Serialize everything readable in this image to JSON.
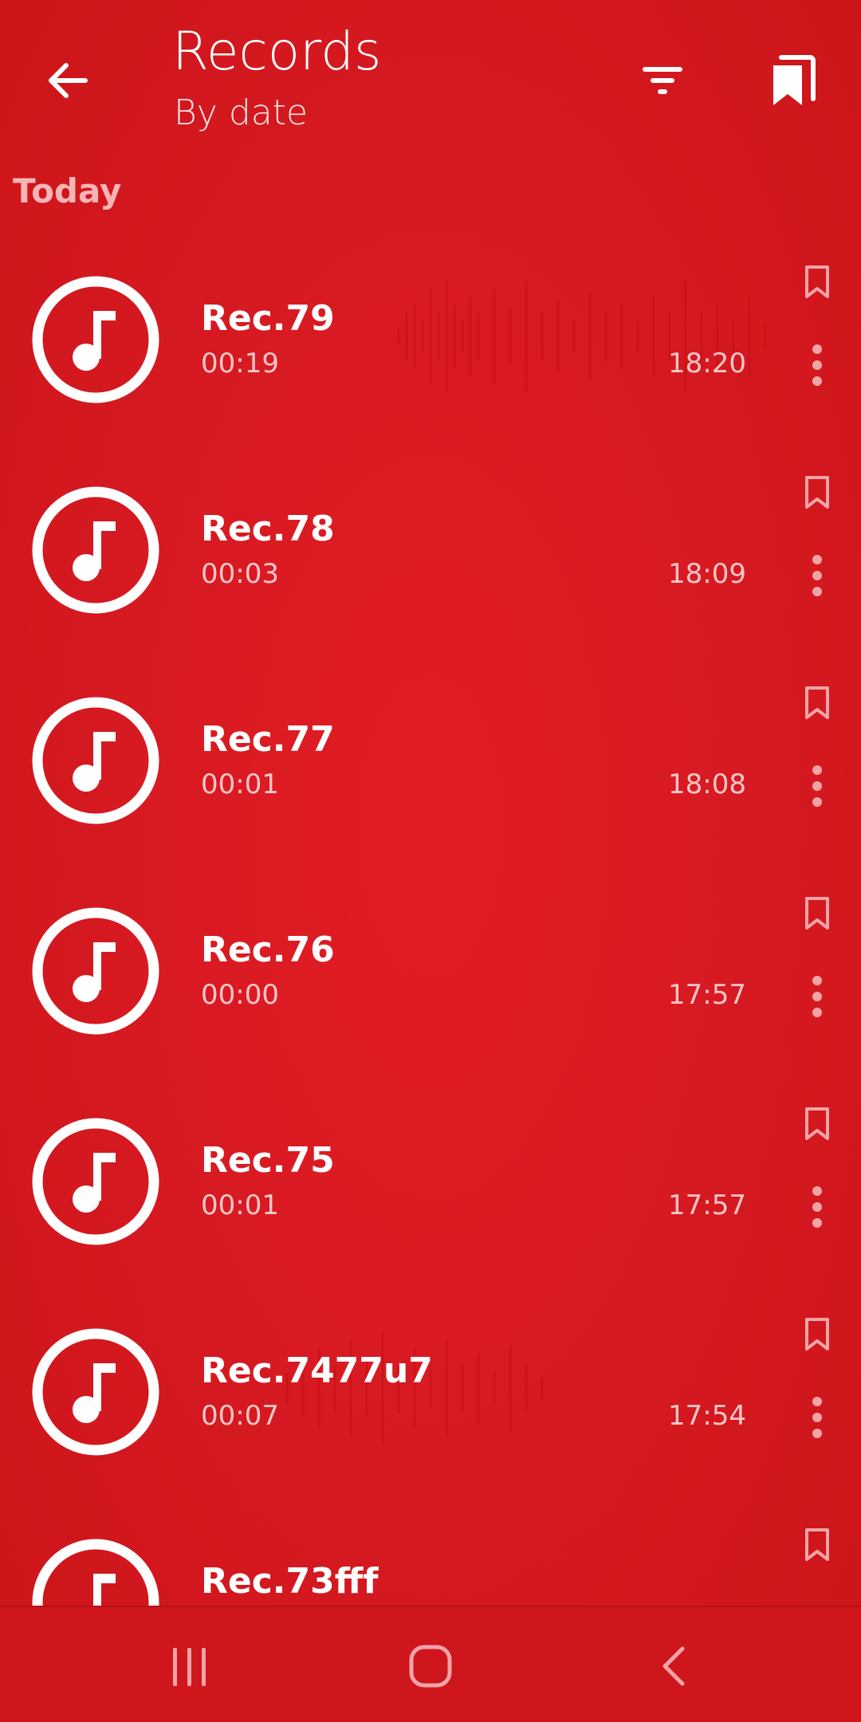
{
  "header": {
    "title": "Records",
    "subtitle": "By date",
    "back_icon": "arrow-back-icon",
    "filter_icon": "filter-icon",
    "bookmarks_icon": "bookmarks-icon"
  },
  "section": {
    "label": "Today"
  },
  "records": [
    {
      "name": "Rec.79",
      "duration": "00:19",
      "time": "18:20"
    },
    {
      "name": "Rec.78",
      "duration": "00:03",
      "time": "18:09"
    },
    {
      "name": "Rec.77",
      "duration": "00:01",
      "time": "18:08"
    },
    {
      "name": "Rec.76",
      "duration": "00:00",
      "time": "17:57"
    },
    {
      "name": "Rec.75",
      "duration": "00:01",
      "time": "17:57"
    },
    {
      "name": "Rec.7477u7",
      "duration": "00:07",
      "time": "17:54"
    },
    {
      "name": "Rec.73fff",
      "duration": "",
      "time": ""
    }
  ],
  "row_icons": {
    "avatar": "music-note-icon",
    "bookmark": "bookmark-outline-icon",
    "more": "more-vert-icon"
  },
  "nav": {
    "recents_icon": "recent-apps-icon",
    "home_icon": "home-icon",
    "back_icon": "nav-back-icon"
  },
  "colors": {
    "background": "#d81a22",
    "text": "#ffffff",
    "section_label": "#f5b5b7",
    "secondary_text": "#f6c6c8"
  }
}
